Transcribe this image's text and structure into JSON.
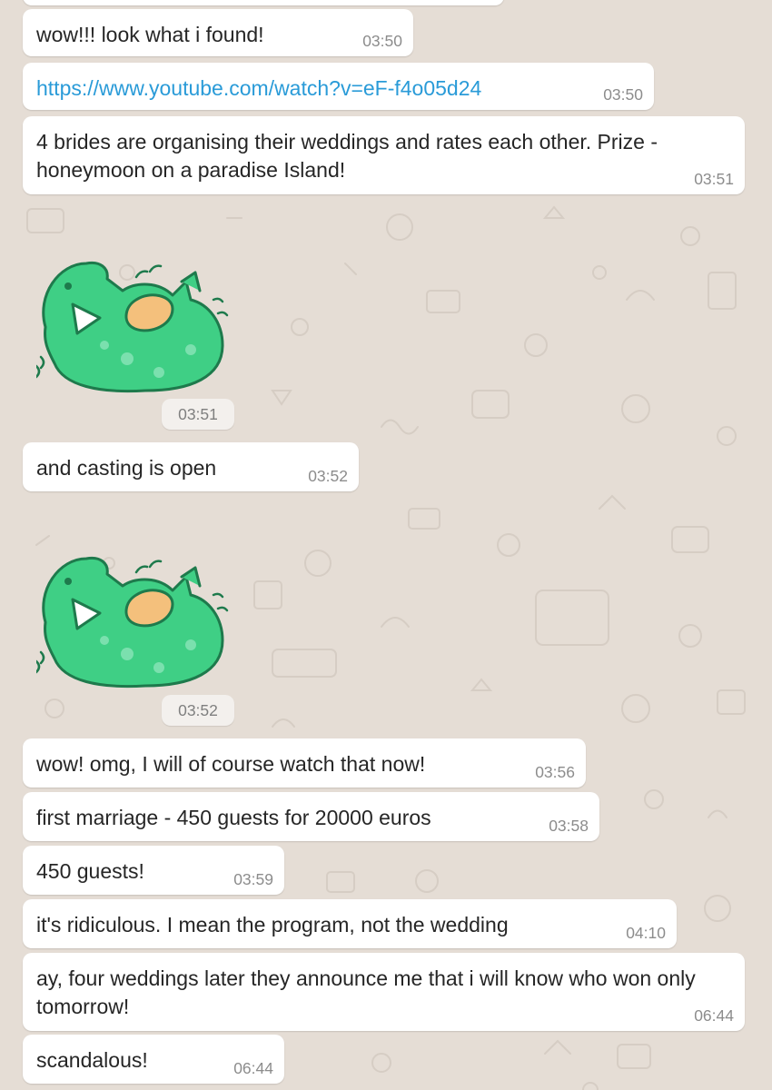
{
  "colors": {
    "chat_background": "#e5ddd5",
    "bubble_background": "#ffffff",
    "text": "#262626",
    "timestamp": "#8c8c8c",
    "link": "#2a9bd8",
    "sticker_green": "#3fcf85"
  },
  "messages": [
    {
      "text": "wow!!! look what i found!",
      "time": "03:50"
    },
    {
      "text": "https://www.youtube.com/watch?v=eF-f4o05d24",
      "time": "03:50"
    },
    {
      "text": "4 brides are organising their weddings and rates each other. Prize - honeymoon on a paradise Island!",
      "time": "03:51"
    },
    {
      "sticker": "laughing-dinosaur-sticker",
      "time": "03:51"
    },
    {
      "text": "and casting is open",
      "time": "03:52"
    },
    {
      "sticker": "laughing-dinosaur-sticker",
      "time": "03:52"
    },
    {
      "text": "wow! omg, I will of course watch that now!",
      "time": "03:56"
    },
    {
      "text": "first marriage - 450 guests for 20000 euros",
      "time": "03:58"
    },
    {
      "text": "450 guests!",
      "time": "03:59"
    },
    {
      "text": "it's ridiculous. I mean the program, not the wedding",
      "time": "04:10"
    },
    {
      "text": "ay, four weddings later they announce me that i will know who won only tomorrow!",
      "time": "06:44"
    },
    {
      "text": "scandalous!",
      "time": "06:44"
    }
  ]
}
